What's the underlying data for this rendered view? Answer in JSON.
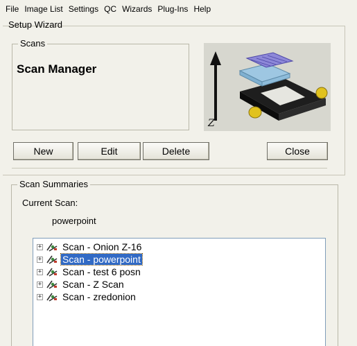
{
  "menu": [
    "File",
    "Image List",
    "Settings",
    "QC",
    "Wizards",
    "Plug-Ins",
    "Help"
  ],
  "wizard": {
    "title": "Setup Wizard"
  },
  "scans_group": {
    "legend": "Scans",
    "heading": "Scan Manager"
  },
  "image": {
    "axis_label": "Z"
  },
  "buttons": {
    "new": "New",
    "edit": "Edit",
    "delete": "Delete",
    "close": "Close"
  },
  "summaries": {
    "legend": "Scan Summaries",
    "current_label": "Current Scan:",
    "current_value": "powerpoint",
    "tree": [
      {
        "label": "Scan - Onion Z-16",
        "selected": false
      },
      {
        "label": "Scan - powerpoint",
        "selected": true
      },
      {
        "label": "Scan - test 6 posn",
        "selected": false
      },
      {
        "label": "Scan - Z Scan",
        "selected": false
      },
      {
        "label": "Scan - zredonion",
        "selected": false
      }
    ]
  },
  "colors": {
    "selection": "#316ac5",
    "window_bg": "#f2f1ea",
    "image_bg": "#d7d7cf"
  },
  "icons": {
    "tree_expander": "plus-box-icon",
    "scan_item": "scan-icon"
  }
}
